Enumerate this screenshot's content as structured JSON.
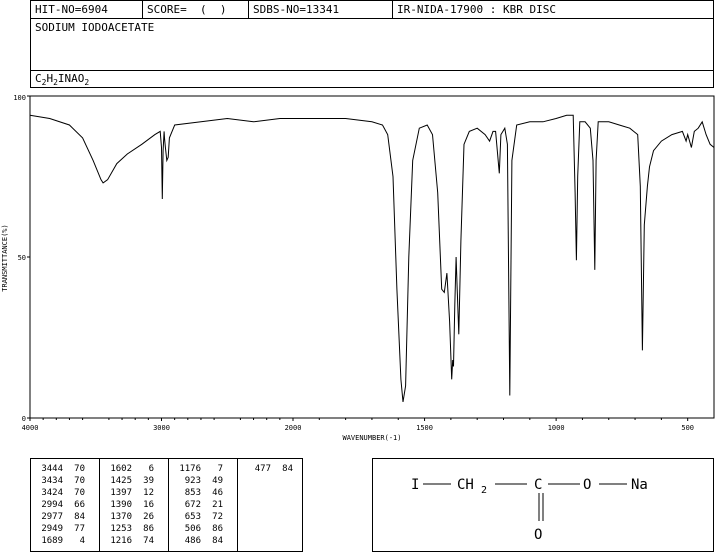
{
  "header": {
    "hit_no": "HIT-NO=6904",
    "score": "SCORE=  (  )",
    "sdbs_no": "SDBS-NO=13341",
    "method": "IR-NIDA-17900 : KBR DISC",
    "compound_name": "SODIUM IODOACETATE",
    "formula_parts": [
      "C",
      "2",
      "H",
      "2",
      "INAO",
      "2"
    ]
  },
  "chart_data": {
    "type": "line",
    "xlabel": "WAVENUMBER(-1)",
    "ylabel": "TRANSMITTANCE(%)",
    "xlim": [
      4000,
      400
    ],
    "ylim": [
      0,
      100
    ],
    "x_ticks": [
      "4000",
      "3000",
      "2000",
      "1500",
      "1000",
      "500"
    ],
    "y_ticks": [
      "100",
      "50",
      "0"
    ],
    "series": [
      {
        "points": [
          [
            4000,
            94
          ],
          [
            3850,
            93
          ],
          [
            3700,
            91
          ],
          [
            3600,
            87
          ],
          [
            3520,
            80
          ],
          [
            3460,
            74
          ],
          [
            3444,
            73
          ],
          [
            3410,
            74
          ],
          [
            3340,
            79
          ],
          [
            3260,
            82
          ],
          [
            3150,
            85
          ],
          [
            3050,
            88
          ],
          [
            3010,
            89
          ],
          [
            3000,
            84
          ],
          [
            2994,
            68
          ],
          [
            2988,
            83
          ],
          [
            2980,
            89
          ],
          [
            2977,
            87
          ],
          [
            2970,
            84
          ],
          [
            2960,
            80
          ],
          [
            2949,
            81
          ],
          [
            2940,
            87
          ],
          [
            2900,
            91
          ],
          [
            2700,
            92
          ],
          [
            2500,
            93
          ],
          [
            2300,
            92
          ],
          [
            2100,
            93
          ],
          [
            1900,
            93
          ],
          [
            1800,
            93
          ],
          [
            1700,
            92
          ],
          [
            1660,
            91
          ],
          [
            1640,
            88
          ],
          [
            1620,
            75
          ],
          [
            1605,
            40
          ],
          [
            1590,
            12
          ],
          [
            1582,
            5
          ],
          [
            1572,
            10
          ],
          [
            1560,
            50
          ],
          [
            1545,
            80
          ],
          [
            1520,
            90
          ],
          [
            1490,
            91
          ],
          [
            1470,
            88
          ],
          [
            1450,
            70
          ],
          [
            1435,
            40
          ],
          [
            1425,
            39
          ],
          [
            1415,
            45
          ],
          [
            1405,
            30
          ],
          [
            1397,
            12
          ],
          [
            1393,
            18
          ],
          [
            1390,
            16
          ],
          [
            1385,
            35
          ],
          [
            1380,
            50
          ],
          [
            1376,
            40
          ],
          [
            1370,
            26
          ],
          [
            1362,
            55
          ],
          [
            1350,
            85
          ],
          [
            1330,
            89
          ],
          [
            1300,
            90
          ],
          [
            1270,
            88
          ],
          [
            1253,
            86
          ],
          [
            1240,
            89
          ],
          [
            1230,
            89
          ],
          [
            1216,
            76
          ],
          [
            1210,
            88
          ],
          [
            1195,
            90
          ],
          [
            1185,
            85
          ],
          [
            1176,
            7
          ],
          [
            1168,
            80
          ],
          [
            1150,
            91
          ],
          [
            1100,
            92
          ],
          [
            1050,
            92
          ],
          [
            1000,
            93
          ],
          [
            960,
            94
          ],
          [
            935,
            94
          ],
          [
            928,
            70
          ],
          [
            923,
            49
          ],
          [
            918,
            75
          ],
          [
            910,
            92
          ],
          [
            890,
            92
          ],
          [
            870,
            90
          ],
          [
            860,
            80
          ],
          [
            853,
            46
          ],
          [
            848,
            80
          ],
          [
            840,
            92
          ],
          [
            800,
            92
          ],
          [
            760,
            91
          ],
          [
            720,
            90
          ],
          [
            690,
            88
          ],
          [
            680,
            72
          ],
          [
            672,
            21
          ],
          [
            665,
            60
          ],
          [
            653,
            72
          ],
          [
            645,
            78
          ],
          [
            630,
            83
          ],
          [
            600,
            86
          ],
          [
            560,
            88
          ],
          [
            520,
            89
          ],
          [
            506,
            86
          ],
          [
            500,
            88
          ],
          [
            486,
            84
          ],
          [
            475,
            89
          ],
          [
            460,
            90
          ],
          [
            445,
            92
          ],
          [
            430,
            88
          ],
          [
            415,
            85
          ],
          [
            400,
            84
          ]
        ]
      }
    ]
  },
  "peak_table": {
    "columns": [
      [
        [
          "3444",
          "70"
        ],
        [
          "3434",
          "70"
        ],
        [
          "3424",
          "70"
        ],
        [
          "2994",
          "66"
        ],
        [
          "2977",
          "84"
        ],
        [
          "2949",
          "77"
        ],
        [
          "1689",
          "4"
        ]
      ],
      [
        [
          "1602",
          "6"
        ],
        [
          "1425",
          "39"
        ],
        [
          "1397",
          "12"
        ],
        [
          "1390",
          "16"
        ],
        [
          "1370",
          "26"
        ],
        [
          "1253",
          "86"
        ],
        [
          "1216",
          "74"
        ]
      ],
      [
        [
          "1176",
          "7"
        ],
        [
          "923",
          "49"
        ],
        [
          "853",
          "46"
        ],
        [
          "672",
          "21"
        ],
        [
          "653",
          "72"
        ],
        [
          "506",
          "86"
        ],
        [
          "486",
          "84"
        ]
      ],
      [
        [
          "477",
          "84"
        ]
      ]
    ]
  },
  "structure": {
    "atom_i": "I",
    "atom_ch2": "CH",
    "ch2_sub": "2",
    "atom_c": "C",
    "atom_o": "O",
    "atom_na": "Na",
    "atom_o_double": "O"
  }
}
